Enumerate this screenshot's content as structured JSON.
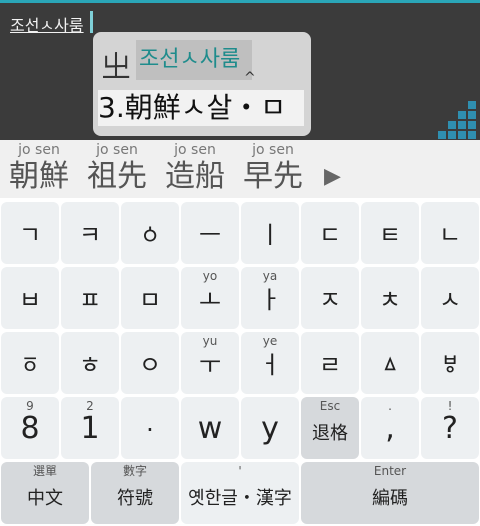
{
  "editor": {
    "typed_text": "조선ㅅ사룸",
    "popup": {
      "radical": "㞢",
      "reading": "조선ㅅ사룸",
      "caret": "^",
      "candidate": "3.朝鮮ㅅ살・ㅁ"
    }
  },
  "suggestions": [
    {
      "reading": "jo sen",
      "word": "朝鮮"
    },
    {
      "reading": "jo sen",
      "word": "祖先"
    },
    {
      "reading": "jo sen",
      "word": "造船"
    },
    {
      "reading": "jo sen",
      "word": "早先"
    }
  ],
  "suggestion_more": "▶",
  "keyboard": {
    "row1": [
      {
        "hint": "",
        "main": "ㄱ"
      },
      {
        "hint": "",
        "main": "ㅋ"
      },
      {
        "hint": "",
        "main": "ㆁ"
      },
      {
        "hint": "",
        "main": "ㅡ"
      },
      {
        "hint": "",
        "main": "ㅣ"
      },
      {
        "hint": "",
        "main": "ㄷ"
      },
      {
        "hint": "",
        "main": "ㅌ"
      },
      {
        "hint": "",
        "main": "ㄴ"
      }
    ],
    "row2": [
      {
        "hint": "",
        "main": "ㅂ"
      },
      {
        "hint": "",
        "main": "ㅍ"
      },
      {
        "hint": "",
        "main": "ㅁ"
      },
      {
        "hint": "yo",
        "main": "ㅗ"
      },
      {
        "hint": "ya",
        "main": "ㅏ"
      },
      {
        "hint": "",
        "main": "ㅈ"
      },
      {
        "hint": "",
        "main": "ㅊ"
      },
      {
        "hint": "",
        "main": "ㅅ"
      }
    ],
    "row3": [
      {
        "hint": "",
        "main": "ㆆ"
      },
      {
        "hint": "",
        "main": "ㅎ"
      },
      {
        "hint": "",
        "main": "ㅇ"
      },
      {
        "hint": "yu",
        "main": "ㅜ"
      },
      {
        "hint": "ye",
        "main": "ㅓ"
      },
      {
        "hint": "",
        "main": "ㄹ"
      },
      {
        "hint": "",
        "main": "ㅿ"
      },
      {
        "hint": "",
        "main": "ㅸ"
      }
    ],
    "row4": [
      {
        "hint": "9",
        "main": "8"
      },
      {
        "hint": "2",
        "main": "1"
      },
      {
        "hint": "",
        "main": "·"
      },
      {
        "hint": "",
        "main": "w"
      },
      {
        "hint": "",
        "main": "y"
      },
      {
        "hint": "Esc",
        "main": "退格"
      },
      {
        "hint": ".",
        "main": ","
      },
      {
        "hint": "!",
        "main": "?"
      }
    ],
    "row5": [
      {
        "hint": "選單",
        "main": "中文"
      },
      {
        "hint": "數字",
        "main": "符號"
      },
      {
        "hint": "'",
        "main": "옛한글・漢字"
      },
      {
        "hint": "Enter",
        "main": "編碼"
      }
    ]
  },
  "colors": {
    "accent": "#2aa6b8",
    "key_bg": "#edf0f2",
    "key_dark_bg": "#d6d9dc"
  }
}
